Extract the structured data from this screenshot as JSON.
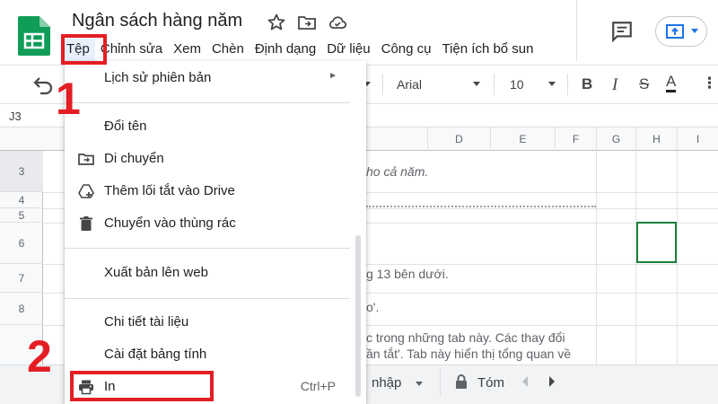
{
  "header": {
    "title": "Ngân sách hàng năm",
    "menu": [
      "Tệp",
      "Chỉnh sửa",
      "Xem",
      "Chèn",
      "Định dạng",
      "Dữ liệu",
      "Công cụ",
      "Tiện ích bổ sun"
    ]
  },
  "toolbar": {
    "font_name": "Arial",
    "font_size": "10",
    "bold": "B",
    "italic": "I",
    "strike": "S",
    "text_color": "A"
  },
  "name_box": "J3",
  "grid": {
    "columns": [
      "D",
      "E",
      "F",
      "G",
      "H",
      "I"
    ],
    "rows": [
      "3",
      "4",
      "5",
      "6",
      "7",
      "8"
    ],
    "cells": {
      "r3": "ho cả năm.",
      "r7": "g 13 bên dưới.",
      "r8": "o'.",
      "r9a": "c trong những tab này. Các thay đổi",
      "r9b": "ần tắt'. Tab này hiển thị tổng quan về"
    }
  },
  "sheet_tabs": {
    "tab1": "nhập",
    "tab2": "Tóm"
  },
  "file_menu": {
    "version_history": "Lịch sử phiên bản",
    "rename": "Đổi tên",
    "move": "Di chuyển",
    "add_shortcut": "Thêm lối tắt vào Drive",
    "trash": "Chuyển vào thùng rác",
    "publish": "Xuất bản lên web",
    "details": "Chi tiết tài liệu",
    "settings": "Cài đặt bảng tính",
    "print": "In",
    "print_shortcut": "Ctrl+P"
  },
  "callouts": {
    "step1": "1",
    "step2": "2"
  },
  "colors": {
    "accent_red": "#e31e24",
    "sheets_green": "#0f9d58",
    "selection_green": "#188038"
  }
}
